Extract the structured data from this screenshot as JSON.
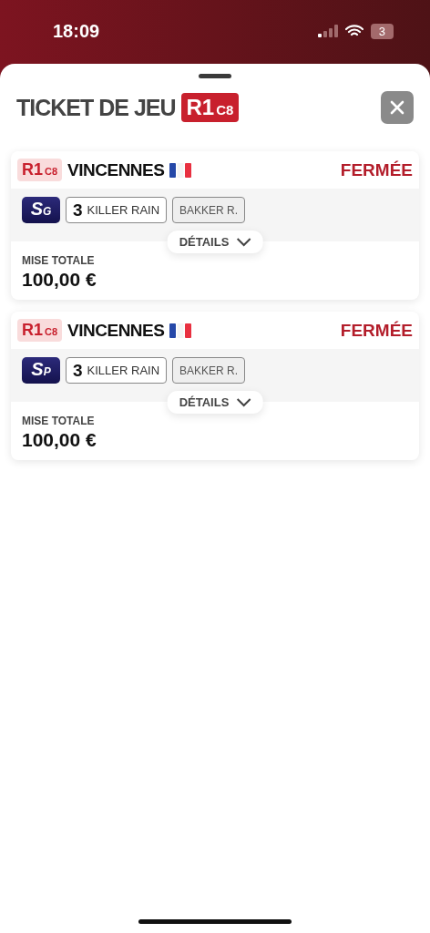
{
  "status_bar": {
    "time": "18:09",
    "battery": "3"
  },
  "sheet": {
    "title": "TICKET DE JEU",
    "reunion": "R1",
    "course": "C8"
  },
  "tickets": [
    {
      "reunion": "R1",
      "course": "C8",
      "venue": "VINCENNES",
      "status": "FERMÉE",
      "bet_type": {
        "main": "S",
        "sub": "G"
      },
      "runner_number": "3",
      "runner_name": "KILLER RAIN",
      "jockey": "BAKKER R.",
      "details_label": "DÉTAILS",
      "stake_label": "MISE TOTALE",
      "stake": "100,00 €"
    },
    {
      "reunion": "R1",
      "course": "C8",
      "venue": "VINCENNES",
      "status": "FERMÉE",
      "bet_type": {
        "main": "S",
        "sub": "P"
      },
      "runner_number": "3",
      "runner_name": "KILLER RAIN",
      "jockey": "BAKKER R.",
      "details_label": "DÉTAILS",
      "stake_label": "MISE TOTALE",
      "stake": "100,00 €"
    }
  ]
}
